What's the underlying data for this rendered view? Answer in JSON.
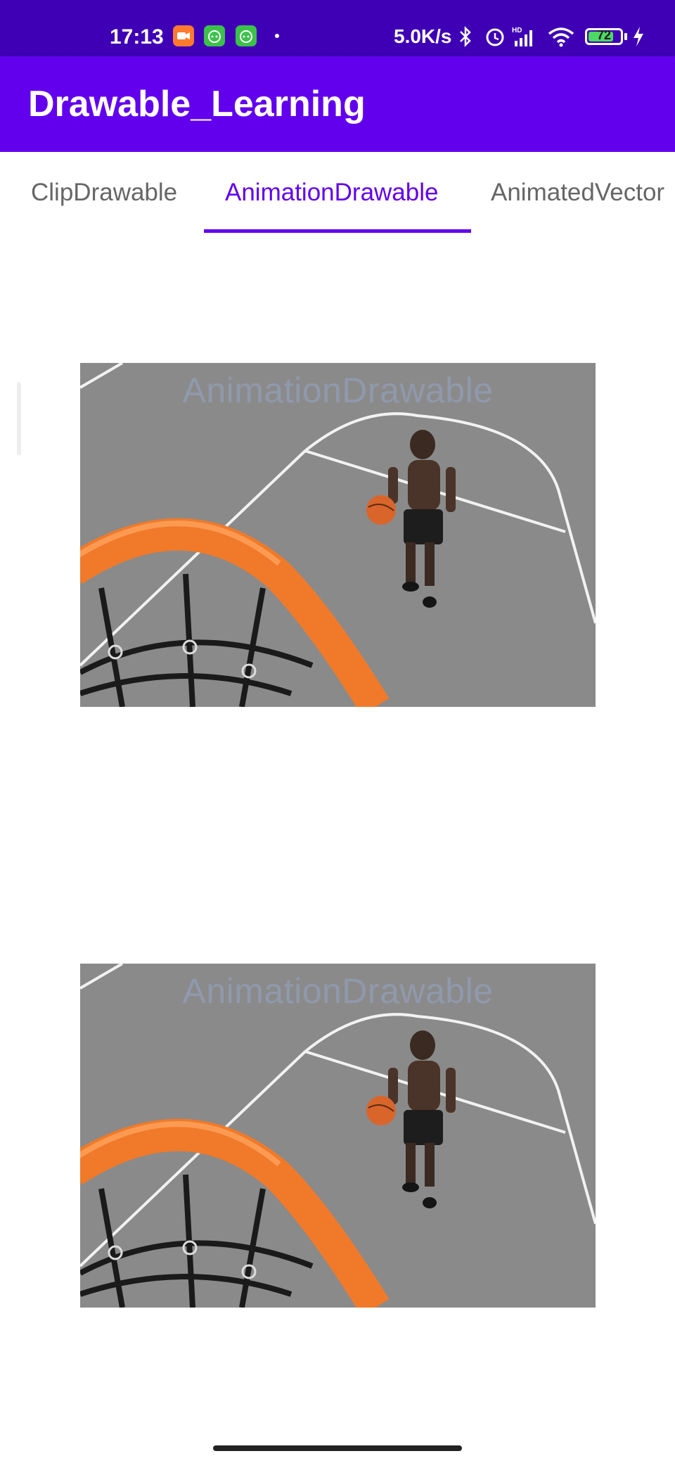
{
  "status_bar": {
    "time": "17:13",
    "network_speed": "5.0K/s",
    "battery": "72",
    "icons": [
      "video-recorder-icon",
      "android-cat-icon",
      "android-cat-icon",
      "bluetooth-icon",
      "alarm-icon",
      "hd-signal-icon",
      "wifi-icon",
      "charging-icon"
    ]
  },
  "app_bar": {
    "title": "Drawable_Learning"
  },
  "tabs": [
    {
      "label": "ClipDrawable",
      "selected": false
    },
    {
      "label": "AnimationDrawable",
      "selected": true
    },
    {
      "label": "AnimatedVector",
      "selected": false
    }
  ],
  "content": {
    "images": [
      {
        "overlay_text": "AnimationDrawable",
        "subject": "basketball player on court with hoop"
      },
      {
        "overlay_text": "AnimationDrawable",
        "subject": "basketball player on court with hoop"
      }
    ]
  },
  "colors": {
    "primary": "#6200ee",
    "status_bar": "#3f00b5",
    "court": "#8e8e8e",
    "hoop": "#f07a2a"
  }
}
